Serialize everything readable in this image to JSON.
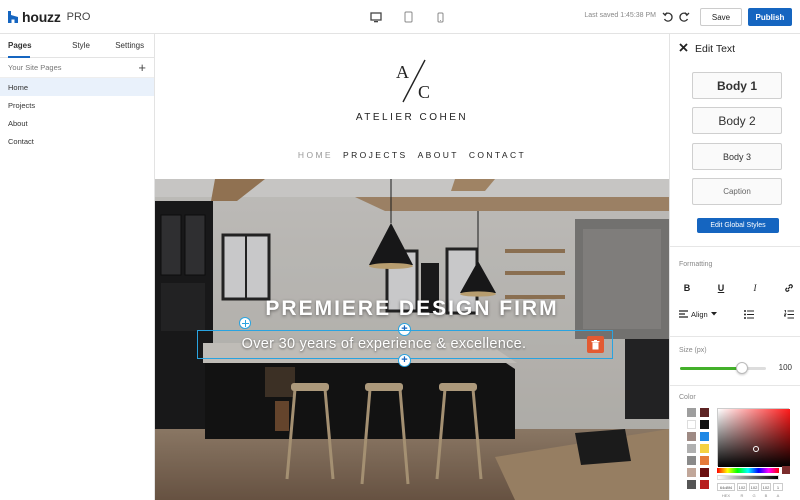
{
  "app": {
    "name": "houzz",
    "suffix": "PRO"
  },
  "toolbar": {
    "last_saved": "Last saved 1:45:38 PM",
    "save_label": "Save",
    "publish_label": "Publish",
    "devices": [
      "desktop-icon",
      "tablet-icon",
      "mobile-icon"
    ]
  },
  "left_panel": {
    "tabs": [
      {
        "label": "Pages",
        "active": true
      },
      {
        "label": "Style",
        "active": false
      },
      {
        "label": "Settings",
        "active": false
      }
    ],
    "pages_header": "Your Site Pages",
    "pages": [
      {
        "label": "Home",
        "active": true
      },
      {
        "label": "Projects",
        "active": false
      },
      {
        "label": "About",
        "active": false
      },
      {
        "label": "Contact",
        "active": false
      }
    ]
  },
  "site": {
    "monogram_left": "A",
    "monogram_right": "C",
    "brand_name": "ATELIER COHEN",
    "nav": [
      {
        "label": "HOME",
        "current": true
      },
      {
        "label": "PROJECTS",
        "current": false
      },
      {
        "label": "ABOUT",
        "current": false
      },
      {
        "label": "CONTACT",
        "current": false
      }
    ],
    "hero_title": "PREMIERE DESIGN FIRM",
    "hero_subtitle": "Over 30 years of experience & excellence."
  },
  "right_panel": {
    "title": "Edit Text",
    "text_styles": [
      "Body 1",
      "Body 2",
      "Body 3",
      "Caption"
    ],
    "edit_global_styles": "Edit Global Styles",
    "formatting_label": "Formatting",
    "formatting": {
      "bold": "B",
      "underline": "U",
      "italic": "I",
      "align": "Align"
    },
    "size_label": "Size (px)",
    "size_value": "100",
    "size_fraction": 0.72,
    "color_label": "Color",
    "swatches": [
      "#9e9e9e",
      "#5d2424",
      "#ffffff",
      "#111111",
      "#9e8a84",
      "#1e88e5",
      "#b0b0b0",
      "#f5d142",
      "#8a8a8a",
      "#e57a3a",
      "#c1a79a",
      "#6b1010",
      "#555555",
      "#b71c1c"
    ],
    "current_color": "#7b2d2d",
    "color_inputs": [
      "64d8f4",
      "102",
      "102",
      "102",
      "1"
    ],
    "color_input_labels": [
      "HEX",
      "R",
      "G",
      "B",
      "A"
    ]
  },
  "colors": {
    "accent": "#1565c0",
    "selection": "#29a3e0",
    "delete": "#e35a32",
    "slider": "#43b02a"
  }
}
